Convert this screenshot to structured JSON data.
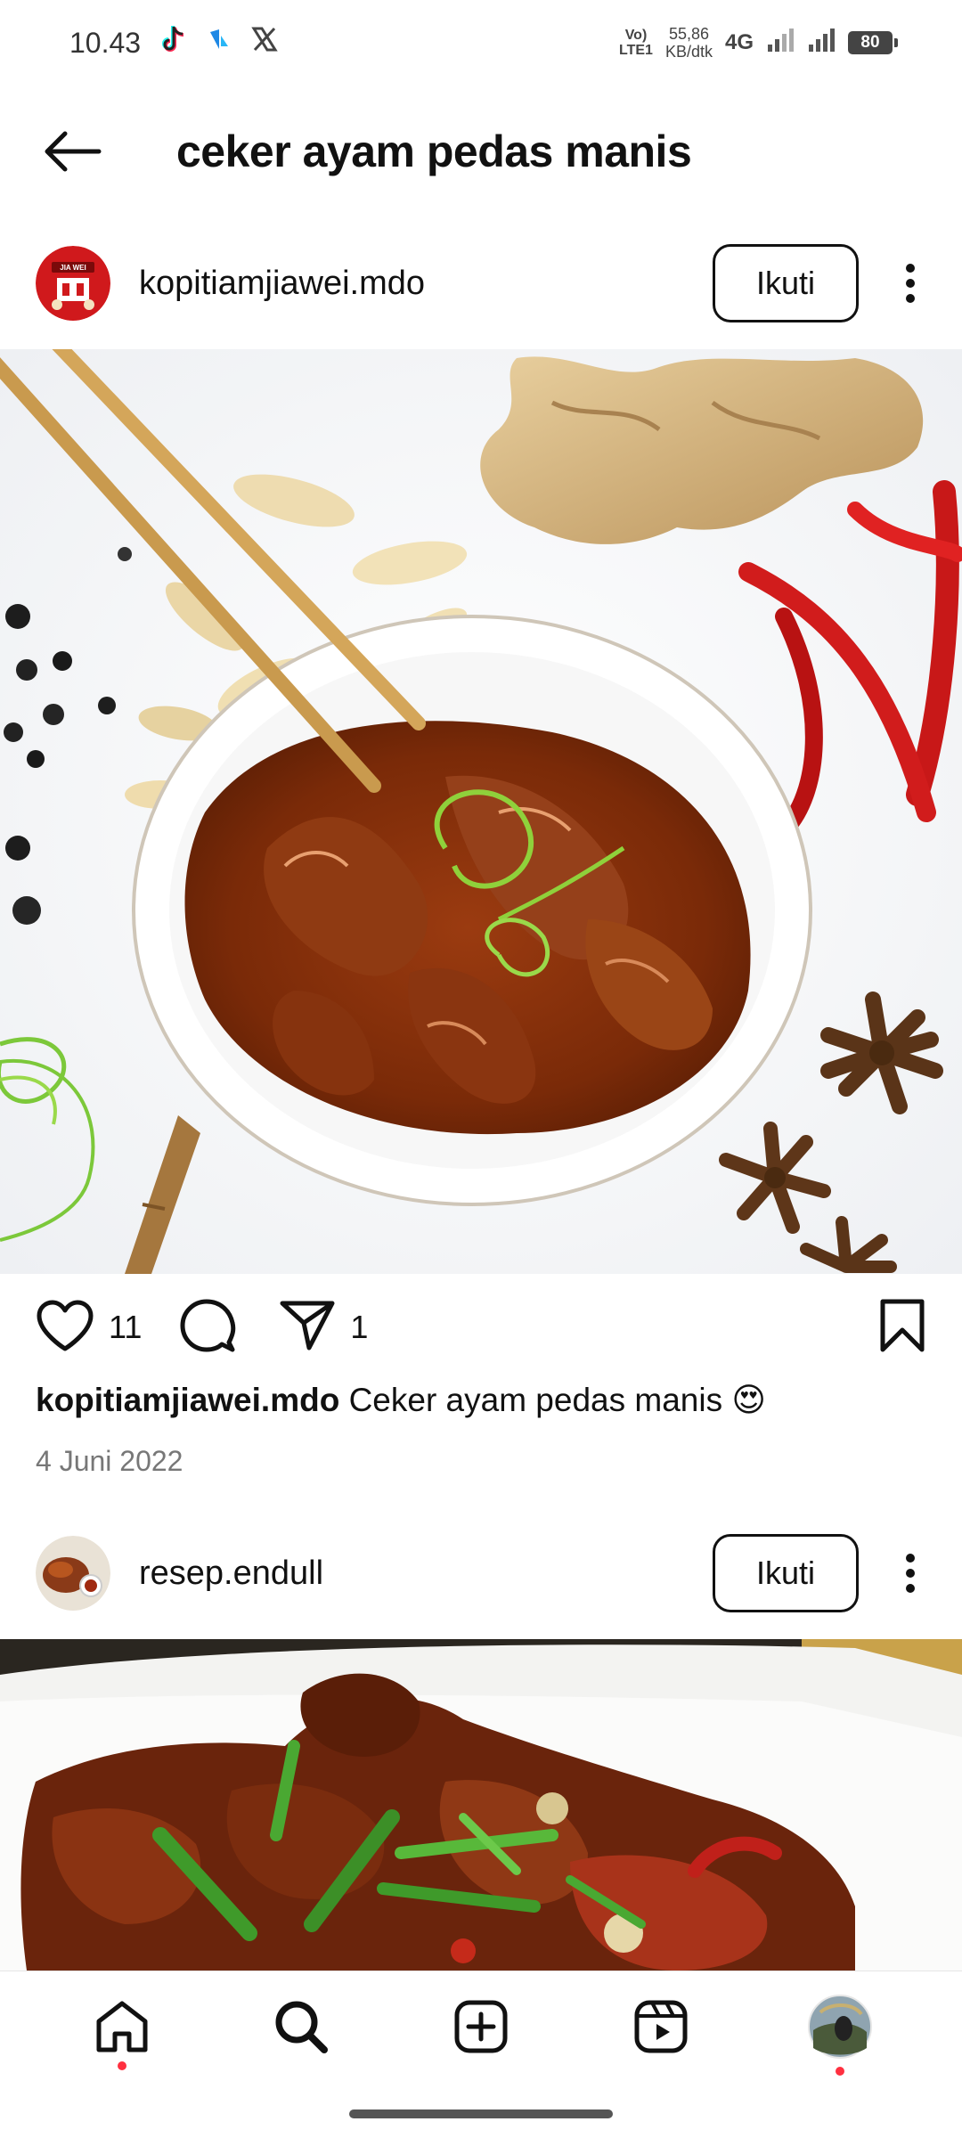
{
  "status_bar": {
    "time": "10.43",
    "volte_top": "Vo)",
    "volte_bottom": "LTE1",
    "speed_value": "55,86",
    "speed_unit": "KB/dtk",
    "network": "4G",
    "battery": "80"
  },
  "header": {
    "title": "ceker ayam pedas manis"
  },
  "posts": [
    {
      "username": "kopitiamjiawei.mdo",
      "avatar_label": "JIA WEI",
      "follow_label": "Ikuti",
      "likes": "11",
      "shares": "1",
      "caption_user": "kopitiamjiawei.mdo",
      "caption_text": "Ceker ayam pedas manis 😍",
      "date": "4 Juni 2022"
    },
    {
      "username": "resep.endull",
      "follow_label": "Ikuti"
    }
  ],
  "colors": {
    "accent_red": "#ff3040",
    "text": "#111111",
    "muted": "#777777"
  }
}
